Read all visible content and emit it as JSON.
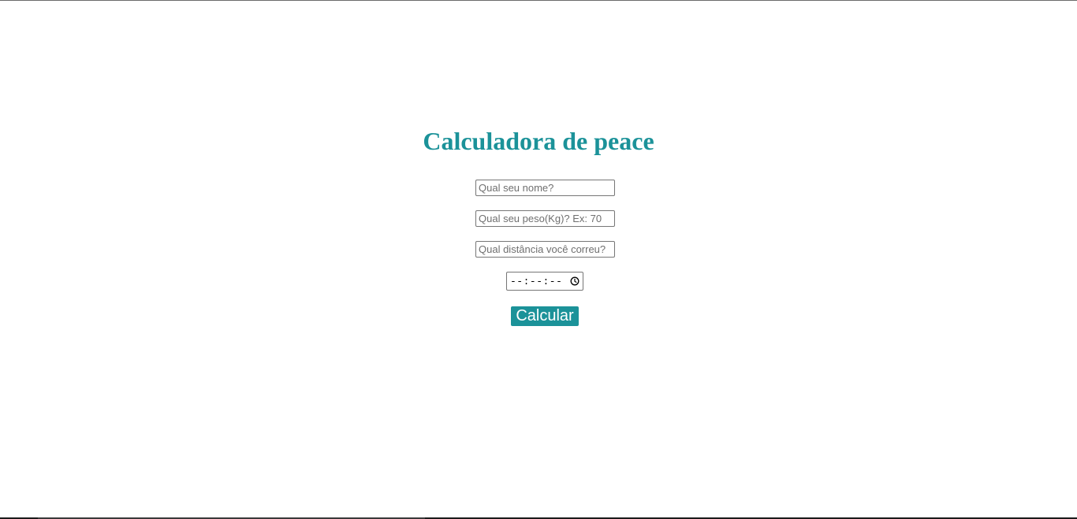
{
  "page": {
    "title": "Calculadora de peace",
    "accent_color": "#1b9299"
  },
  "form": {
    "name_placeholder": "Qual seu nome?",
    "weight_placeholder": "Qual seu peso(Kg)? Ex: 70",
    "distance_placeholder": "Qual distância você correu?",
    "time_value": "--:--:--",
    "time_icon": "clock-icon",
    "submit_label": "Calcular"
  }
}
